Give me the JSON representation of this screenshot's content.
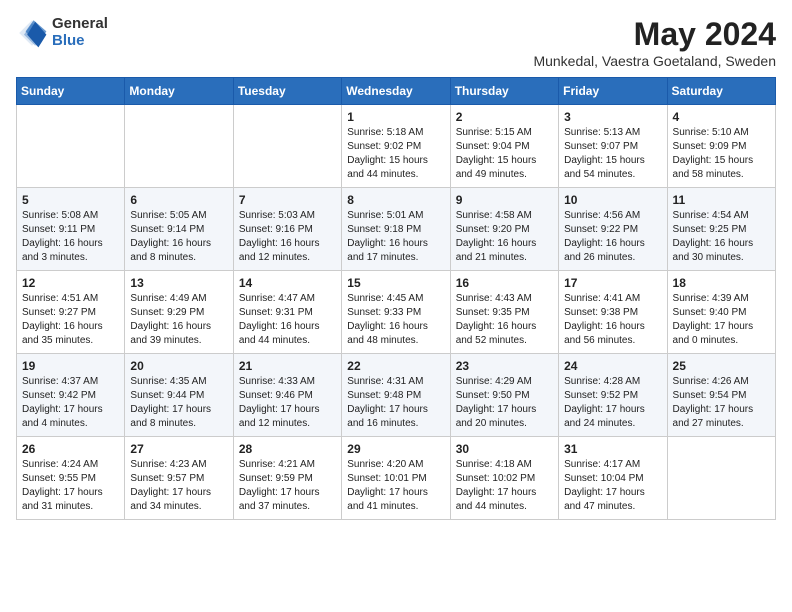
{
  "logo": {
    "general": "General",
    "blue": "Blue"
  },
  "title": {
    "month": "May 2024",
    "location": "Munkedal, Vaestra Goetaland, Sweden"
  },
  "weekdays": [
    "Sunday",
    "Monday",
    "Tuesday",
    "Wednesday",
    "Thursday",
    "Friday",
    "Saturday"
  ],
  "weeks": [
    [
      {
        "day": "",
        "sunrise": "",
        "sunset": "",
        "daylight": ""
      },
      {
        "day": "",
        "sunrise": "",
        "sunset": "",
        "daylight": ""
      },
      {
        "day": "",
        "sunrise": "",
        "sunset": "",
        "daylight": ""
      },
      {
        "day": "1",
        "sunrise": "Sunrise: 5:18 AM",
        "sunset": "Sunset: 9:02 PM",
        "daylight": "Daylight: 15 hours and 44 minutes."
      },
      {
        "day": "2",
        "sunrise": "Sunrise: 5:15 AM",
        "sunset": "Sunset: 9:04 PM",
        "daylight": "Daylight: 15 hours and 49 minutes."
      },
      {
        "day": "3",
        "sunrise": "Sunrise: 5:13 AM",
        "sunset": "Sunset: 9:07 PM",
        "daylight": "Daylight: 15 hours and 54 minutes."
      },
      {
        "day": "4",
        "sunrise": "Sunrise: 5:10 AM",
        "sunset": "Sunset: 9:09 PM",
        "daylight": "Daylight: 15 hours and 58 minutes."
      }
    ],
    [
      {
        "day": "5",
        "sunrise": "Sunrise: 5:08 AM",
        "sunset": "Sunset: 9:11 PM",
        "daylight": "Daylight: 16 hours and 3 minutes."
      },
      {
        "day": "6",
        "sunrise": "Sunrise: 5:05 AM",
        "sunset": "Sunset: 9:14 PM",
        "daylight": "Daylight: 16 hours and 8 minutes."
      },
      {
        "day": "7",
        "sunrise": "Sunrise: 5:03 AM",
        "sunset": "Sunset: 9:16 PM",
        "daylight": "Daylight: 16 hours and 12 minutes."
      },
      {
        "day": "8",
        "sunrise": "Sunrise: 5:01 AM",
        "sunset": "Sunset: 9:18 PM",
        "daylight": "Daylight: 16 hours and 17 minutes."
      },
      {
        "day": "9",
        "sunrise": "Sunrise: 4:58 AM",
        "sunset": "Sunset: 9:20 PM",
        "daylight": "Daylight: 16 hours and 21 minutes."
      },
      {
        "day": "10",
        "sunrise": "Sunrise: 4:56 AM",
        "sunset": "Sunset: 9:22 PM",
        "daylight": "Daylight: 16 hours and 26 minutes."
      },
      {
        "day": "11",
        "sunrise": "Sunrise: 4:54 AM",
        "sunset": "Sunset: 9:25 PM",
        "daylight": "Daylight: 16 hours and 30 minutes."
      }
    ],
    [
      {
        "day": "12",
        "sunrise": "Sunrise: 4:51 AM",
        "sunset": "Sunset: 9:27 PM",
        "daylight": "Daylight: 16 hours and 35 minutes."
      },
      {
        "day": "13",
        "sunrise": "Sunrise: 4:49 AM",
        "sunset": "Sunset: 9:29 PM",
        "daylight": "Daylight: 16 hours and 39 minutes."
      },
      {
        "day": "14",
        "sunrise": "Sunrise: 4:47 AM",
        "sunset": "Sunset: 9:31 PM",
        "daylight": "Daylight: 16 hours and 44 minutes."
      },
      {
        "day": "15",
        "sunrise": "Sunrise: 4:45 AM",
        "sunset": "Sunset: 9:33 PM",
        "daylight": "Daylight: 16 hours and 48 minutes."
      },
      {
        "day": "16",
        "sunrise": "Sunrise: 4:43 AM",
        "sunset": "Sunset: 9:35 PM",
        "daylight": "Daylight: 16 hours and 52 minutes."
      },
      {
        "day": "17",
        "sunrise": "Sunrise: 4:41 AM",
        "sunset": "Sunset: 9:38 PM",
        "daylight": "Daylight: 16 hours and 56 minutes."
      },
      {
        "day": "18",
        "sunrise": "Sunrise: 4:39 AM",
        "sunset": "Sunset: 9:40 PM",
        "daylight": "Daylight: 17 hours and 0 minutes."
      }
    ],
    [
      {
        "day": "19",
        "sunrise": "Sunrise: 4:37 AM",
        "sunset": "Sunset: 9:42 PM",
        "daylight": "Daylight: 17 hours and 4 minutes."
      },
      {
        "day": "20",
        "sunrise": "Sunrise: 4:35 AM",
        "sunset": "Sunset: 9:44 PM",
        "daylight": "Daylight: 17 hours and 8 minutes."
      },
      {
        "day": "21",
        "sunrise": "Sunrise: 4:33 AM",
        "sunset": "Sunset: 9:46 PM",
        "daylight": "Daylight: 17 hours and 12 minutes."
      },
      {
        "day": "22",
        "sunrise": "Sunrise: 4:31 AM",
        "sunset": "Sunset: 9:48 PM",
        "daylight": "Daylight: 17 hours and 16 minutes."
      },
      {
        "day": "23",
        "sunrise": "Sunrise: 4:29 AM",
        "sunset": "Sunset: 9:50 PM",
        "daylight": "Daylight: 17 hours and 20 minutes."
      },
      {
        "day": "24",
        "sunrise": "Sunrise: 4:28 AM",
        "sunset": "Sunset: 9:52 PM",
        "daylight": "Daylight: 17 hours and 24 minutes."
      },
      {
        "day": "25",
        "sunrise": "Sunrise: 4:26 AM",
        "sunset": "Sunset: 9:54 PM",
        "daylight": "Daylight: 17 hours and 27 minutes."
      }
    ],
    [
      {
        "day": "26",
        "sunrise": "Sunrise: 4:24 AM",
        "sunset": "Sunset: 9:55 PM",
        "daylight": "Daylight: 17 hours and 31 minutes."
      },
      {
        "day": "27",
        "sunrise": "Sunrise: 4:23 AM",
        "sunset": "Sunset: 9:57 PM",
        "daylight": "Daylight: 17 hours and 34 minutes."
      },
      {
        "day": "28",
        "sunrise": "Sunrise: 4:21 AM",
        "sunset": "Sunset: 9:59 PM",
        "daylight": "Daylight: 17 hours and 37 minutes."
      },
      {
        "day": "29",
        "sunrise": "Sunrise: 4:20 AM",
        "sunset": "Sunset: 10:01 PM",
        "daylight": "Daylight: 17 hours and 41 minutes."
      },
      {
        "day": "30",
        "sunrise": "Sunrise: 4:18 AM",
        "sunset": "Sunset: 10:02 PM",
        "daylight": "Daylight: 17 hours and 44 minutes."
      },
      {
        "day": "31",
        "sunrise": "Sunrise: 4:17 AM",
        "sunset": "Sunset: 10:04 PM",
        "daylight": "Daylight: 17 hours and 47 minutes."
      },
      {
        "day": "",
        "sunrise": "",
        "sunset": "",
        "daylight": ""
      }
    ]
  ]
}
